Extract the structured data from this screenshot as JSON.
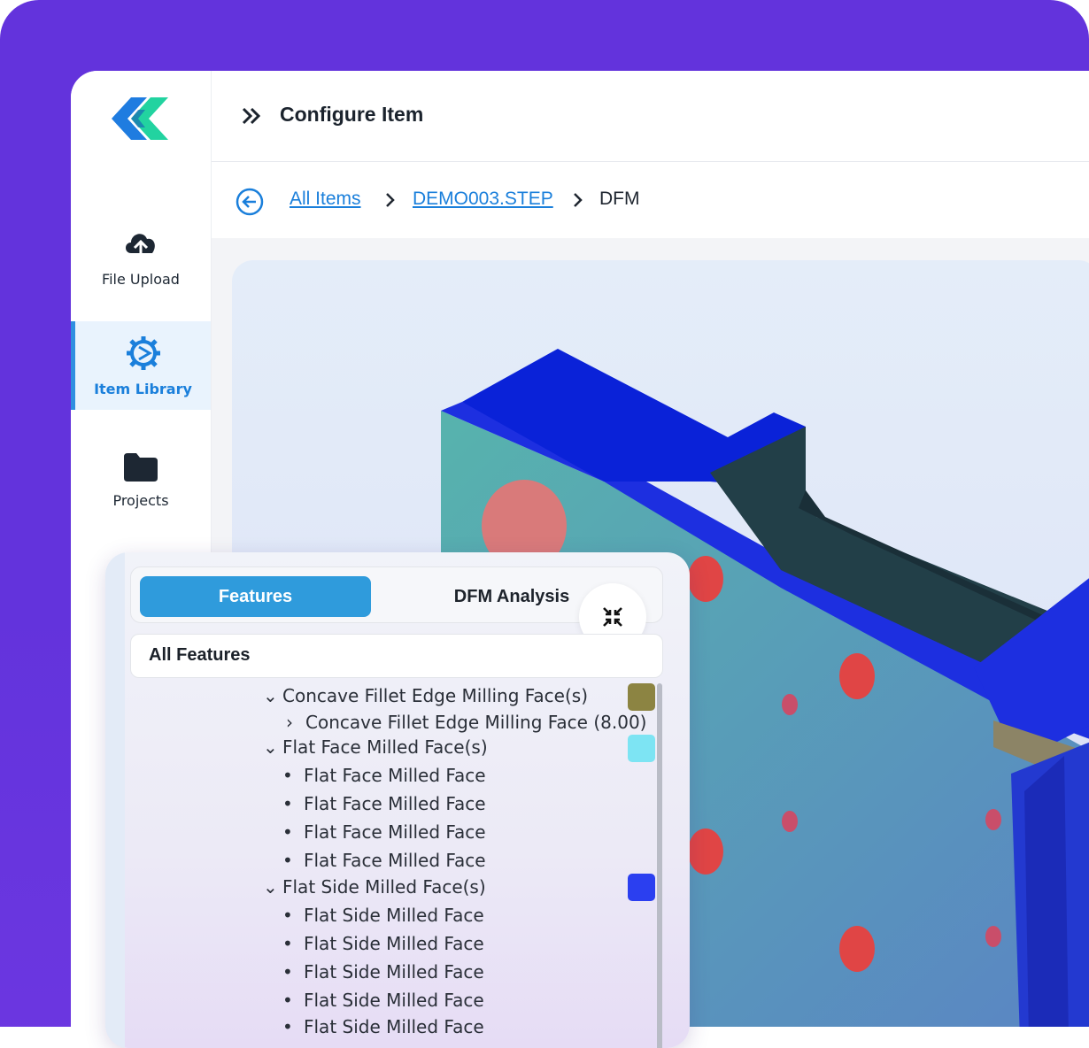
{
  "sidebar": {
    "items": [
      {
        "label": "File Upload",
        "icon": "cloud-upload-icon"
      },
      {
        "label": "Item Library",
        "icon": "gear-library-icon",
        "active": true
      },
      {
        "label": "Projects",
        "icon": "folder-icon"
      }
    ]
  },
  "header": {
    "title": "Configure Item"
  },
  "breadcrumb": {
    "items": [
      "All Items",
      "DEMO003.STEP",
      "DFM"
    ]
  },
  "panel": {
    "tabs": [
      "Features",
      "DFM Analysis"
    ],
    "section_title": "All Features",
    "groups": [
      {
        "label": "Concave Fillet Edge Milling Face(s)",
        "color": "#8c8442",
        "children": [
          "Concave Fillet Edge Milling Face (8.00)"
        ],
        "child_style": "chevron"
      },
      {
        "label": "Flat Face Milled Face(s)",
        "color": "#7de4f3",
        "children": [
          "Flat Face Milled Face",
          "Flat Face Milled Face",
          "Flat Face Milled Face",
          "Flat Face Milled Face"
        ],
        "child_style": "bullet"
      },
      {
        "label": "Flat Side Milled Face(s)",
        "color": "#2b3ff0",
        "children": [
          "Flat Side Milled Face",
          "Flat Side Milled Face",
          "Flat Side Milled Face",
          "Flat Side Milled Face",
          "Flat Side Milled Face"
        ],
        "child_style": "bullet"
      }
    ]
  },
  "colors": {
    "accent": "#2f9bdc",
    "brand_purple": "#6333dc",
    "link": "#1a7fdb"
  }
}
